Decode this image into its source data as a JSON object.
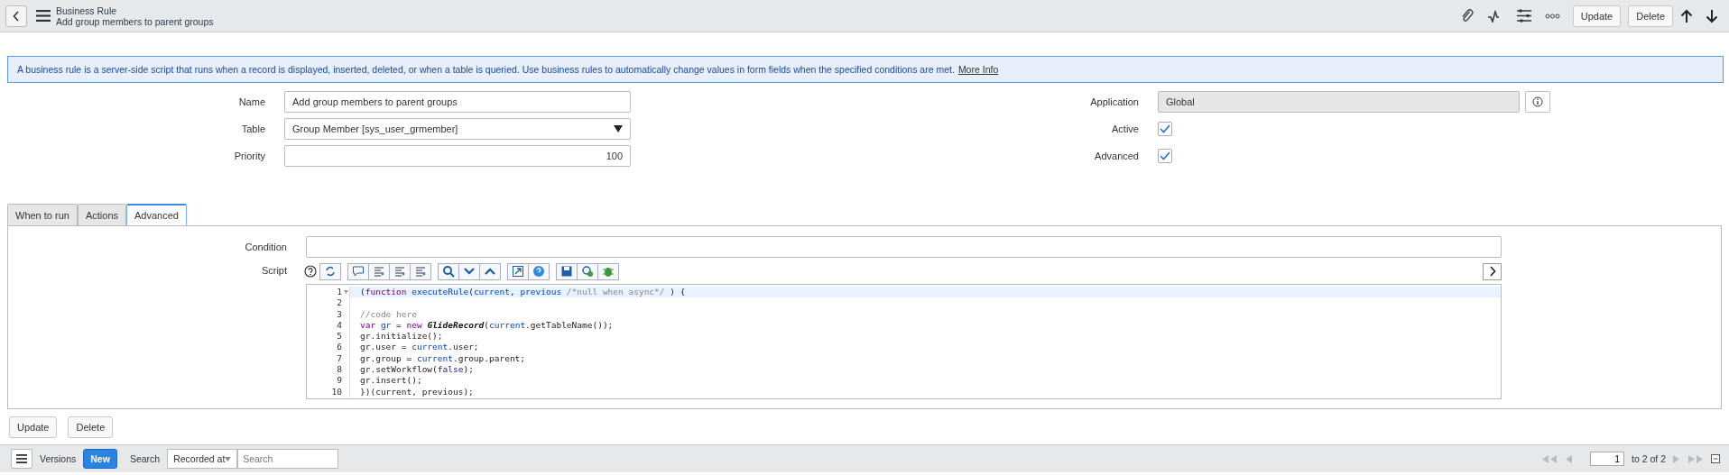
{
  "header": {
    "title": "Business Rule",
    "subtitle": "Add group members to parent groups",
    "buttons": [
      "Update",
      "Delete"
    ]
  },
  "info": {
    "text": "A business rule is a server-side script that runs when a record is displayed, inserted, deleted, or when a table is queried. Use business rules to automatically change values in form fields when the specified conditions are met.",
    "link": "More Info"
  },
  "fields_left": [
    {
      "label": "Name",
      "kind": "text",
      "value": "Add group members to parent groups"
    },
    {
      "label": "Table",
      "kind": "select",
      "value": "Group Member [sys_user_grmember]"
    },
    {
      "label": "Priority",
      "kind": "number",
      "value": "100"
    }
  ],
  "fields_right": [
    {
      "label": "Application",
      "kind": "readonly",
      "value": "Global"
    },
    {
      "label": "Active",
      "kind": "checkbox",
      "checked": true
    },
    {
      "label": "Advanced",
      "kind": "checkbox",
      "checked": true
    }
  ],
  "tabs": [
    {
      "label": "When to run",
      "selected": false
    },
    {
      "label": "Actions",
      "selected": false
    },
    {
      "label": "Advanced",
      "selected": true
    }
  ],
  "condition": {
    "label": "Condition"
  },
  "script": {
    "label": "Script",
    "lines": [
      {
        "number": "1",
        "highlighted": true,
        "tokens": [
          {
            "text": "(",
            "kind": "plain"
          },
          {
            "text": "function",
            "kind": "keyword"
          },
          {
            "text": " executeRule",
            "kind": "def"
          },
          {
            "text": "(",
            "kind": "plain"
          },
          {
            "text": "current",
            "kind": "def"
          },
          {
            "text": ", ",
            "kind": "plain"
          },
          {
            "text": "previous",
            "kind": "def"
          },
          {
            "text": " /*null when async*/",
            "kind": "comment"
          },
          {
            "text": " ) {",
            "kind": "plain"
          }
        ]
      },
      {
        "number": "2",
        "highlighted": false
      },
      {
        "number": "3",
        "highlighted": false,
        "tokens": [
          {
            "text": "//code here",
            "kind": "comment"
          }
        ]
      },
      {
        "number": "4",
        "highlighted": false,
        "tokens": [
          {
            "text": "var",
            "kind": "keyword"
          },
          {
            "text": " gr",
            "kind": "def"
          },
          {
            "text": " = ",
            "kind": "plain"
          },
          {
            "text": "new",
            "kind": "keyword"
          },
          {
            "text": " GlideRecord",
            "kind": "type"
          },
          {
            "text": "(",
            "kind": "plain"
          },
          {
            "text": "current",
            "kind": "def"
          },
          {
            "text": ".getTableName());",
            "kind": "plain"
          }
        ]
      },
      {
        "number": "5",
        "highlighted": false,
        "tokens": [
          {
            "text": "gr.initialize();",
            "kind": "plain"
          }
        ]
      },
      {
        "number": "6",
        "highlighted": false,
        "tokens": [
          {
            "text": "gr.user = ",
            "kind": "plain"
          },
          {
            "text": "current",
            "kind": "def"
          },
          {
            "text": ".user;",
            "kind": "plain"
          }
        ]
      },
      {
        "number": "7",
        "highlighted": false,
        "tokens": [
          {
            "text": "gr.group = ",
            "kind": "plain"
          },
          {
            "text": "current",
            "kind": "def"
          },
          {
            "text": ".group.parent;",
            "kind": "plain"
          }
        ]
      },
      {
        "number": "8",
        "highlighted": false,
        "tokens": [
          {
            "text": "gr.setWorkflow(",
            "kind": "plain"
          },
          {
            "text": "false",
            "kind": "atom"
          },
          {
            "text": ");",
            "kind": "plain"
          }
        ]
      },
      {
        "number": "9",
        "highlighted": false,
        "tokens": [
          {
            "text": "gr.insert();",
            "kind": "plain"
          }
        ]
      },
      {
        "number": "10",
        "highlighted": false,
        "tokens": [
          {
            "text": "})(current, previous);",
            "kind": "plain"
          }
        ]
      }
    ]
  },
  "form_buttons": [
    "Update",
    "Delete"
  ],
  "versions_bar": {
    "title": "Versions",
    "new_button": "New",
    "search_label": "Search",
    "filter": "Recorded at",
    "search_placeholder": "Search",
    "page": "1",
    "page_total": "to 2 of 2"
  }
}
